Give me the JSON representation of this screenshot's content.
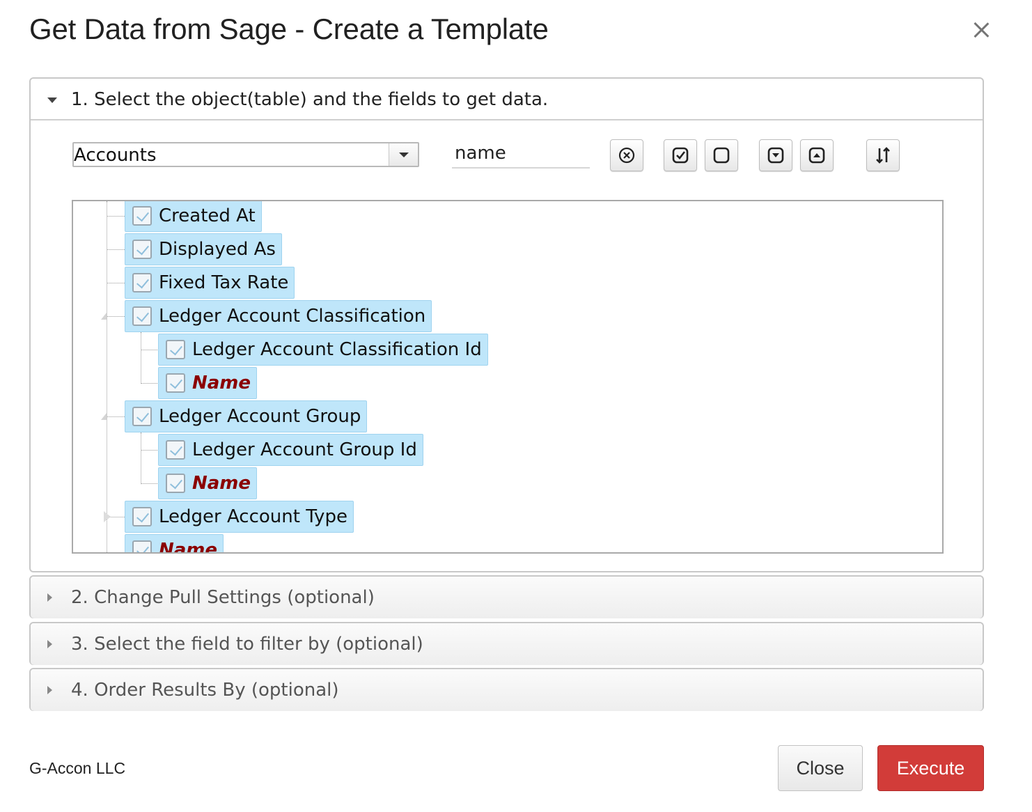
{
  "dialog": {
    "title": "Get Data from Sage - Create a Template"
  },
  "sections": [
    {
      "label": "1. Select the object(table) and the fields to get data.",
      "expanded": true
    },
    {
      "label": "2. Change Pull Settings (optional)",
      "expanded": false
    },
    {
      "label": "3. Select the field to filter by (optional)",
      "expanded": false
    },
    {
      "label": "4. Order Results By (optional)",
      "expanded": false
    }
  ],
  "toolbar": {
    "object_select_value": "Accounts",
    "search_value": "name",
    "buttons": [
      {
        "icon": "clear-circle-icon"
      },
      {
        "icon": "check-all-icon"
      },
      {
        "icon": "uncheck-all-icon"
      },
      {
        "icon": "expand-all-icon"
      },
      {
        "icon": "collapse-all-icon"
      },
      {
        "icon": "sort-icon"
      }
    ]
  },
  "tree": {
    "nodes": [
      {
        "label": "Created At",
        "level": 1,
        "checked": true,
        "key": false
      },
      {
        "label": "Displayed As",
        "level": 1,
        "checked": true,
        "key": false
      },
      {
        "label": "Fixed Tax Rate",
        "level": 1,
        "checked": true,
        "key": false
      },
      {
        "label": "Ledger Account Classification",
        "level": 1,
        "checked": true,
        "key": false,
        "expander": "open"
      },
      {
        "label": "Ledger Account Classification Id",
        "level": 2,
        "checked": true,
        "key": false
      },
      {
        "label": "Name",
        "level": 2,
        "checked": true,
        "key": true
      },
      {
        "label": "Ledger Account Group",
        "level": 1,
        "checked": true,
        "key": false,
        "expander": "open"
      },
      {
        "label": "Ledger Account Group Id",
        "level": 2,
        "checked": true,
        "key": false
      },
      {
        "label": "Name",
        "level": 2,
        "checked": true,
        "key": true
      },
      {
        "label": "Ledger Account Type",
        "level": 1,
        "checked": true,
        "key": false,
        "expander": "closed"
      },
      {
        "label": "Name",
        "level": 1,
        "checked": true,
        "key": true
      }
    ]
  },
  "footer": {
    "brand": "G-Accon LLC",
    "close_label": "Close",
    "execute_label": "Execute"
  },
  "colors": {
    "execute": "#d23c39",
    "node_bg": "#bfe6fa",
    "key_field": "#8b0000"
  }
}
